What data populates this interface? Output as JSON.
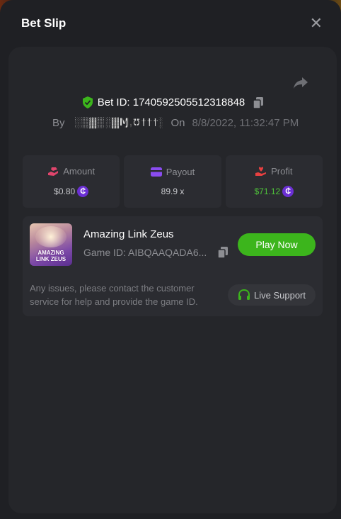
{
  "header": {
    "title": "Bet Slip",
    "close_icon": "close-icon"
  },
  "bet": {
    "id_label": "Bet ID: 1740592505512318848",
    "by_label": "By",
    "username": "░▒▓▒░▓Ɱ,Ʊ†††░▒▓▒",
    "on_label": "On",
    "date": "8/8/2022, 11:32:47 PM"
  },
  "stats": {
    "amount": {
      "label": "Amount",
      "value": "$0.80",
      "icon": "hand-coin-icon"
    },
    "payout": {
      "label": "Payout",
      "value": "89.9 x",
      "icon": "card-icon"
    },
    "profit": {
      "label": "Profit",
      "value": "$71.12",
      "icon": "hand-heart-icon"
    }
  },
  "coin_symbol": "₵",
  "game": {
    "thumb_text_line1": "AMAZING",
    "thumb_text_line2": "LINK ZEUS",
    "name": "Amazing Link Zeus",
    "id": "Game ID: AIBQAAQADA6...",
    "play_label": "Play Now"
  },
  "support": {
    "text": "Any issues, please contact the customer service for help and provide the game ID.",
    "button_label": "Live Support"
  },
  "colors": {
    "accent_green": "#3cb51c",
    "profit_green": "#4fc43a",
    "coin_purple": "#6b2fd4",
    "pink_icon": "#e0456c",
    "purple_icon": "#8a4cf0",
    "red_icon": "#e84040"
  }
}
